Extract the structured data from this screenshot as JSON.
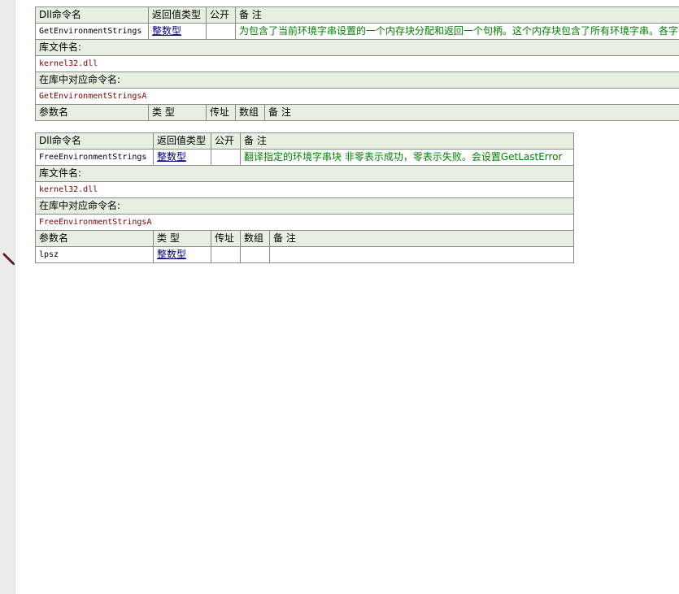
{
  "table1": {
    "headers": [
      "Dll命令名",
      "返回值类型",
      "公开",
      "备 注"
    ],
    "command_name": "GetEnvironmentStrings",
    "return_type": "整数型",
    "public": "",
    "remark": "为包含了当前环境字串设置的一个内存块分配和返回一个句柄。这个内存块包含了所有环境字串。各字",
    "lib_label": "库文件名:",
    "lib_value": "kernel32.dll",
    "alias_label": "在库中对应命令名:",
    "alias_value": "GetEnvironmentStringsA",
    "param_headers": [
      "参数名",
      "类 型",
      "传址",
      "数组",
      "备 注"
    ]
  },
  "table2": {
    "headers": [
      "Dll命令名",
      "返回值类型",
      "公开",
      "备 注"
    ],
    "command_name": "FreeEnvironmentStrings",
    "return_type": "整数型",
    "public": "",
    "remark": "翻译指定的环境字串块  非零表示成功，零表示失败。会设置GetLastError",
    "lib_label": "库文件名:",
    "lib_value": "kernel32.dll",
    "alias_label": "在库中对应命令名:",
    "alias_value": "FreeEnvironmentStringsA",
    "param_headers": [
      "参数名",
      "类 型",
      "传址",
      "数组",
      "备 注"
    ],
    "params": [
      {
        "name": "lpsz",
        "type": "整数型",
        "byref": "",
        "array": "",
        "remark": ""
      }
    ]
  },
  "colors": {
    "header_bg": "#e6efe0",
    "gutter_bg": "#ececec",
    "remark_green": "#008000",
    "lib_red": "#800000",
    "link_blue": "#000080"
  },
  "icons": {
    "gutter": "pencil-icon"
  }
}
